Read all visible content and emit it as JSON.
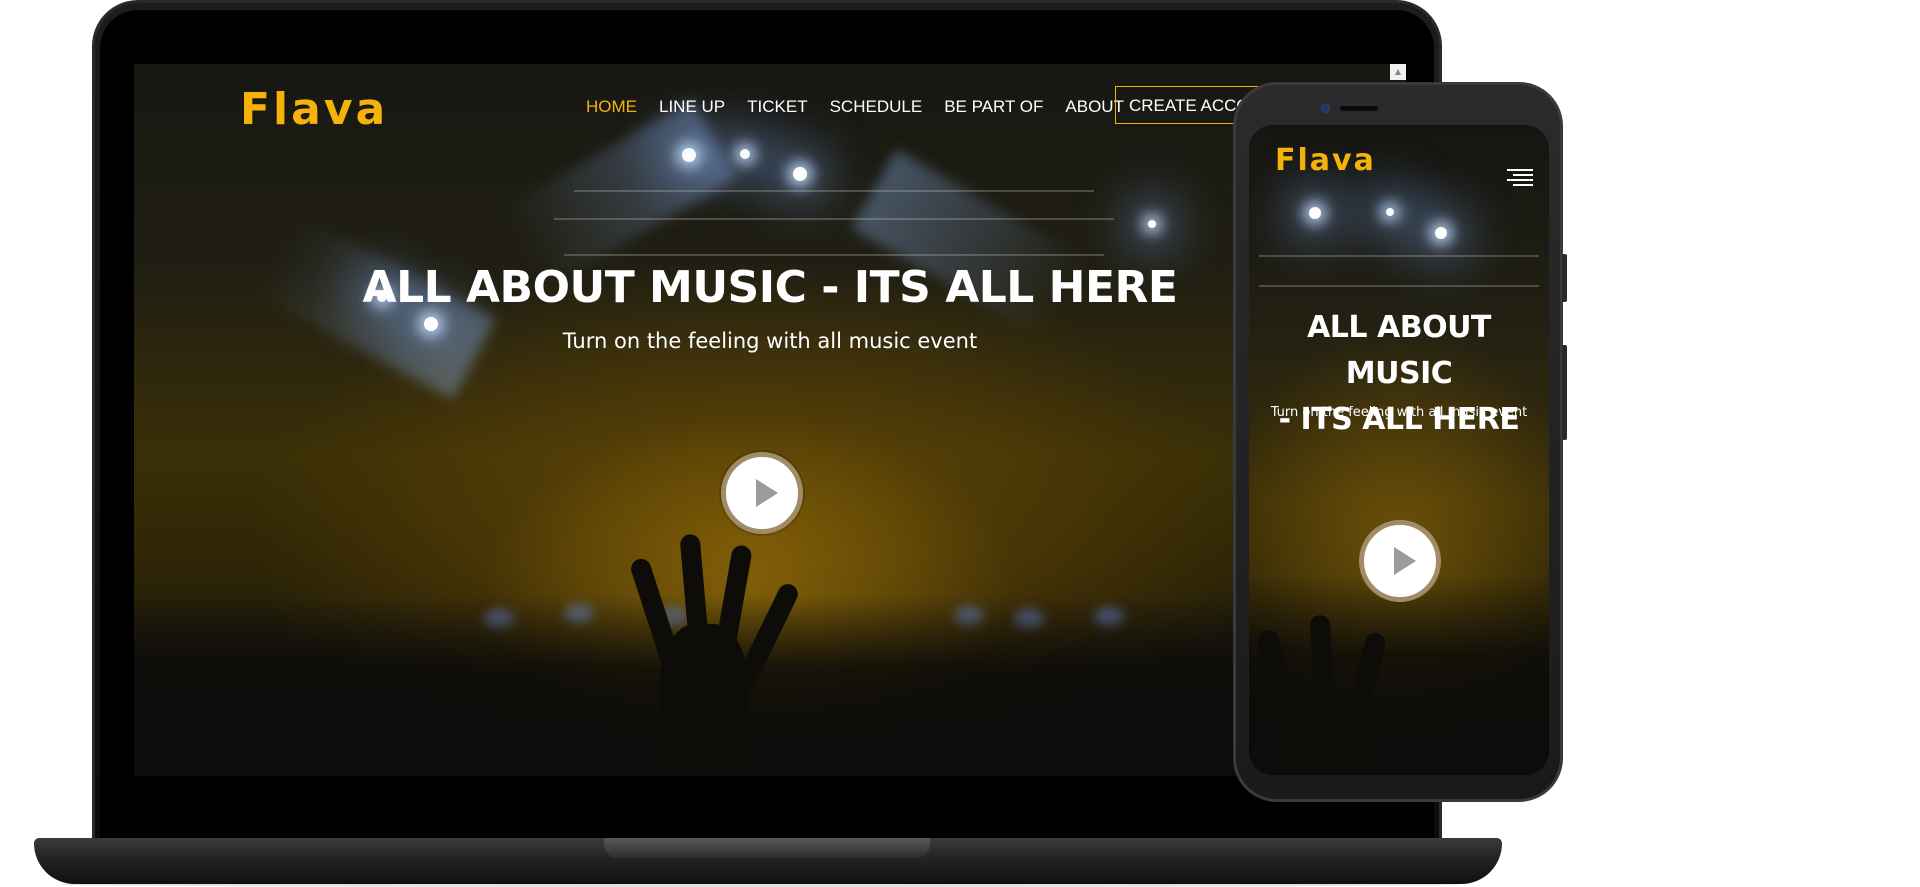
{
  "site": {
    "logo": "Flava",
    "accent_color": "#f5b30a",
    "nav": [
      {
        "label": "HOME",
        "active": true
      },
      {
        "label": "LINE UP",
        "active": false
      },
      {
        "label": "TICKET",
        "active": false
      },
      {
        "label": "SCHEDULE",
        "active": false
      },
      {
        "label": "BE PART OF",
        "active": false
      },
      {
        "label": "ABOUT",
        "active": false
      }
    ],
    "cta_label": "CREATE ACCOUNT",
    "hero": {
      "title": "ALL ABOUT MUSIC - ITS ALL HERE",
      "subtitle": "Turn on the feeling with all music event",
      "play_icon": "play-icon"
    }
  },
  "mobile": {
    "logo": "Flava",
    "menu_icon": "hamburger-menu-icon",
    "title_line1": "ALL ABOUT MUSIC",
    "title_line2": "- ITS ALL HERE",
    "subtitle": "Turn on the feeling with all music event",
    "play_icon": "play-icon"
  }
}
